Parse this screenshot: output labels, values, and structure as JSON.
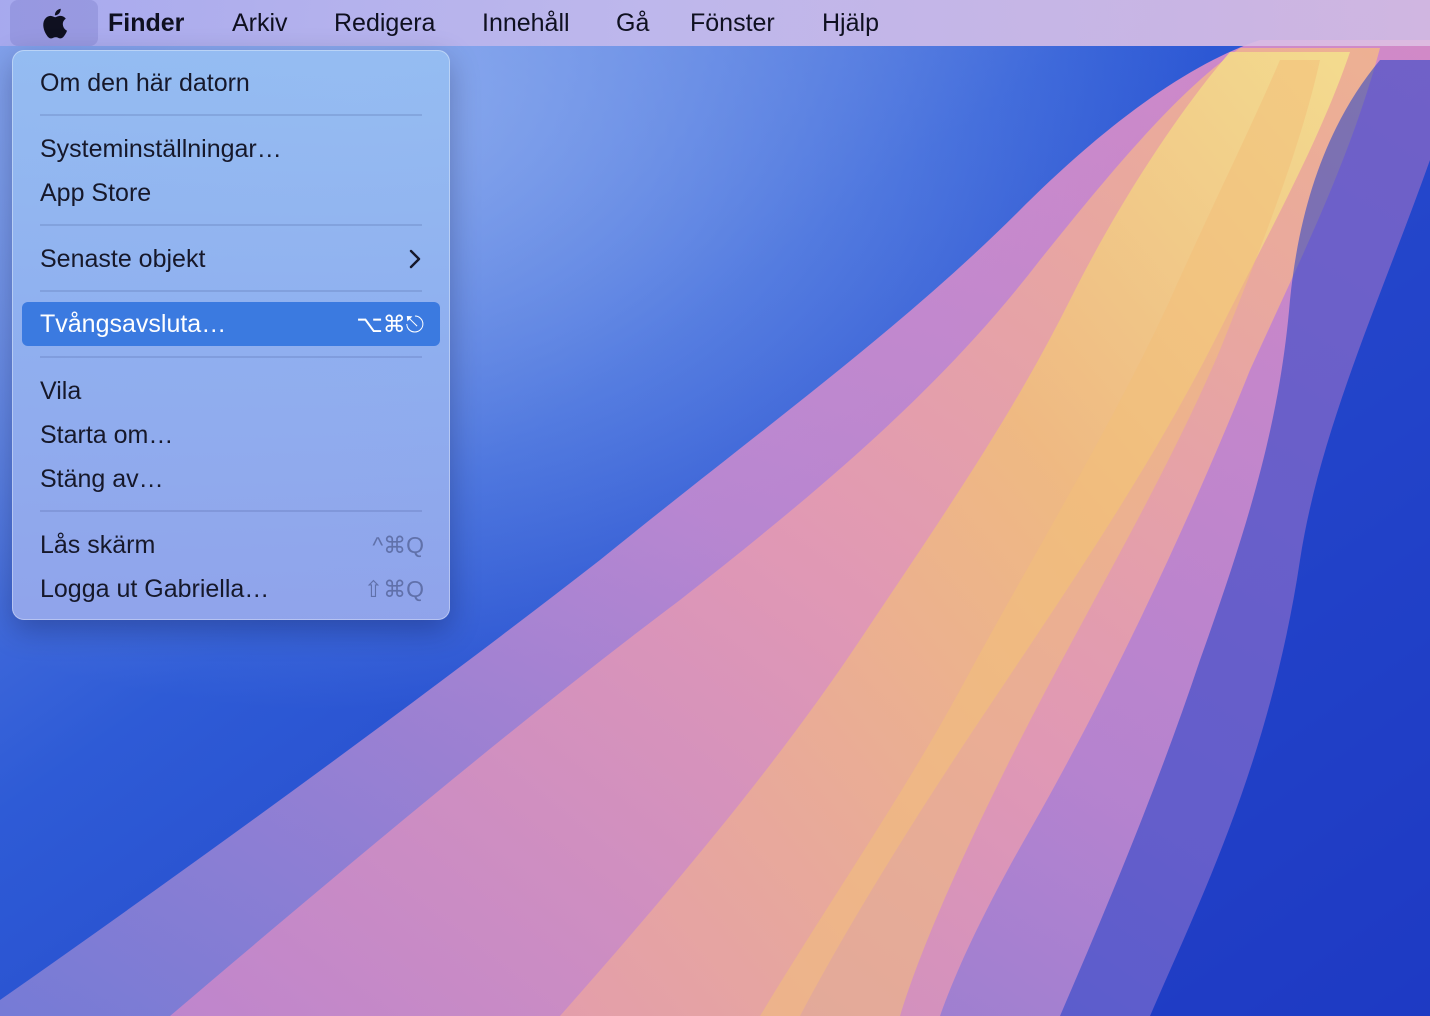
{
  "menubar": {
    "apple_icon": "apple-logo-icon",
    "app_name": "Finder",
    "items": [
      "Arkiv",
      "Redigera",
      "Innehåll",
      "Gå",
      "Fönster",
      "Hjälp"
    ]
  },
  "apple_menu": {
    "about": "Om den här datorn",
    "system_settings": "Systeminställningar…",
    "app_store": "App Store",
    "recent_items": "Senaste objekt",
    "force_quit": "Tvångsavsluta…",
    "force_quit_shortcut": "⌥⌘⎋",
    "sleep": "Vila",
    "restart": "Starta om…",
    "shutdown": "Stäng av…",
    "lock_screen": "Lås skärm",
    "lock_screen_shortcut": "^⌘Q",
    "logout": "Logga ut Gabriella…",
    "logout_shortcut": "⇧⌘Q"
  },
  "colors": {
    "highlight": "#3b7ae0",
    "menu_bg": "#96bef2",
    "wallpaper_blue": "#2f57d0",
    "wallpaper_pink": "#d98ac8",
    "wallpaper_yellow": "#f2d88a"
  }
}
